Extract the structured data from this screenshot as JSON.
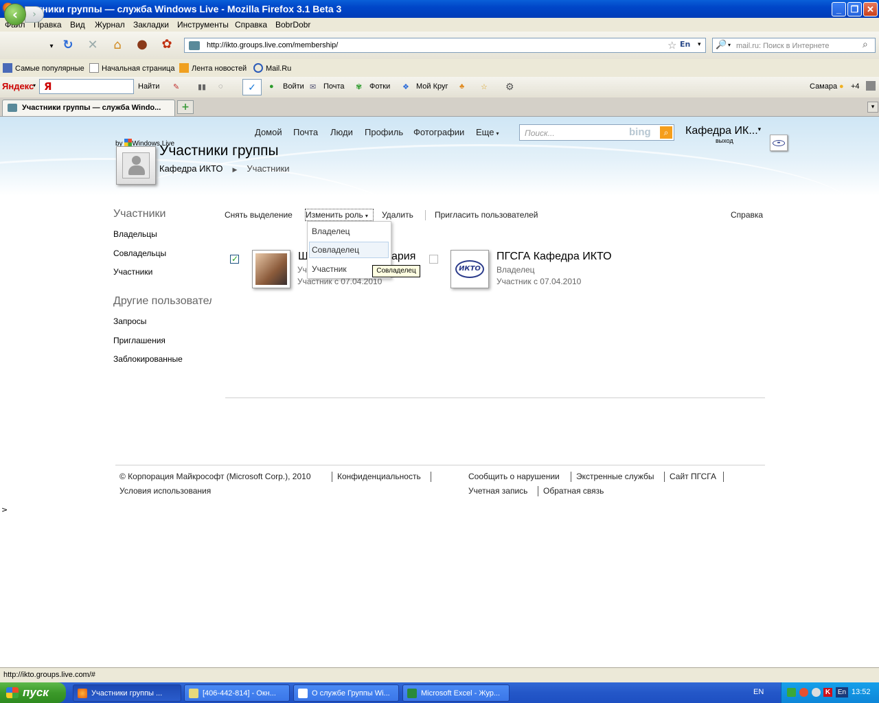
{
  "window": {
    "title": "Участники группы — служба Windows Live - Mozilla Firefox 3.1 Beta 3",
    "minimize": "_",
    "maximize": "❐",
    "close": "✕"
  },
  "menu": [
    "Файл",
    "Правка",
    "Вид",
    "Журнал",
    "Закладки",
    "Инструменты",
    "Справка",
    "BobrDobr"
  ],
  "nav": {
    "url": "http://ikto.groups.live.com/membership/",
    "lang_badge": "En",
    "search_placeholder": "mail.ru: Поиск в Интернете"
  },
  "bookmarks": [
    "Самые популярные",
    "Начальная страница",
    "Лента новостей",
    "Mail.Ru"
  ],
  "yandex_bar": {
    "logo": "Яндекс",
    "find": "Найти",
    "login": "Войти",
    "mail": "Почта",
    "photos": "Фотки",
    "circle": "Мой Круг",
    "city": "Самара",
    "temp": "+4"
  },
  "tabs": [
    {
      "label": "Участники группы — служба Windo...",
      "active": true
    }
  ],
  "page": {
    "topnav": [
      "Домой",
      "Почта",
      "Люди",
      "Профиль",
      "Фотографии",
      "Еще"
    ],
    "search_placeholder": "Поиск...",
    "bing": "bing",
    "account": "Кафедра ИК...",
    "signout": "выход",
    "by_windows_live": "by",
    "windows_live": "Windows Live",
    "group_title": "Участники группы",
    "breadcrumb": [
      "Кафедра ИКТО",
      "Участники"
    ],
    "sidebar": {
      "members_heading": "Участники",
      "members_items": [
        "Владельцы",
        "Совладельцы",
        "Участники"
      ],
      "others_heading": "Другие пользователи",
      "others_items": [
        "Запросы",
        "Приглашения",
        "Заблокированные"
      ]
    },
    "actions": {
      "deselect": "Снять выделение",
      "change_role": "Изменить роль",
      "delete": "Удалить",
      "invite": "Пригласить пользователей",
      "help": "Справка"
    },
    "role_menu": [
      "Владелец",
      "Совладелец",
      "Участник"
    ],
    "tooltip": "Совладелец",
    "members": [
      {
        "name": "Ш",
        "name_tail": "ария",
        "role": "Уч",
        "since": "Участник с 07.04.2010",
        "checked": true
      },
      {
        "name": "ПГСГА Кафедра ИКТО",
        "role": "Владелец",
        "since": "Участник с 07.04.2010",
        "checked": false,
        "logo": "ИКТО"
      }
    ],
    "footer": {
      "copyright": "© Корпорация Майкрософт (Microsoft Corp.), 2010",
      "privacy": "Конфиденциальность",
      "terms": "Условия использования",
      "report": "Сообщить о нарушении",
      "emergency": "Экстренные службы",
      "site": "Сайт ПГСГА",
      "account": "Учетная запись",
      "feedback": "Обратная связь"
    },
    "stray_char": ">"
  },
  "status": "http://ikto.groups.live.com/#",
  "taskbar": {
    "start": "пуск",
    "tasks": [
      "Участники группы ...",
      "[406-442-814] - Окн...",
      "О службе Группы Wi...",
      "Microsoft Excel - Жур..."
    ],
    "lang": "EN",
    "tray_lang": "En",
    "time": "13:52"
  },
  "colors": {
    "titlebar": "#0046c8",
    "taskbar": "#2457c8",
    "start": "#3c9a2a",
    "tick": "#21a121"
  }
}
